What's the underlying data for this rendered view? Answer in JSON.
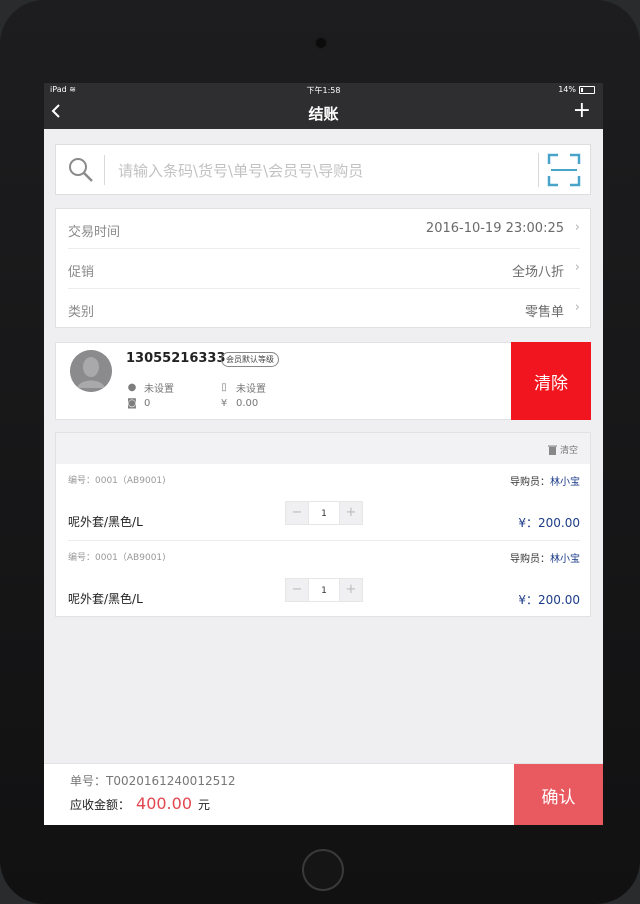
{
  "status_bar": {
    "carrier": "iPad",
    "time": "下午1:58",
    "battery": "14%"
  },
  "nav": {
    "back_icon": "chevron-left-icon",
    "title": "结账",
    "add_icon": "plus-icon",
    "add_label": "+"
  },
  "search": {
    "placeholder": "请输入条码\\货号\\单号\\会员号\\导购员",
    "value": ""
  },
  "info": {
    "trade_time_label": "交易时间",
    "trade_time_value": "2016-10-19 23:00:25",
    "promo_label": "促销",
    "promo_value": "全场八折",
    "category_label": "类别",
    "category_value": "零售单"
  },
  "member": {
    "phone": "13055216333",
    "level": "会员默认等级",
    "name": "未设置",
    "mobile": "未设置",
    "points": "0",
    "balance": "0.00",
    "clear_label": "清除"
  },
  "cart": {
    "clear_label": "清空",
    "items": [
      {
        "code": "编号：0001（AB9001)",
        "guide_label": "导购员：",
        "guide_name": "林小宝",
        "name": "呢外套/黑色/L",
        "qty": "1",
        "price": "¥：200.00"
      },
      {
        "code": "编号：0001（AB9001)",
        "guide_label": "导购员：",
        "guide_name": "林小宝",
        "name": "呢外套/黑色/L",
        "qty": "1",
        "price": "¥：200.00"
      }
    ]
  },
  "footer": {
    "order_no": "单号：T0020161240012512",
    "amount_label": "应收金额：",
    "amount_value": "400.00",
    "currency": "元",
    "confirm_label": "确认"
  },
  "colors": {
    "nav_bg": "#2e2e30",
    "clear_member": "#f0151e",
    "confirm": "#e85a60",
    "amount": "#e2474d",
    "guide": "#1c3c88"
  }
}
